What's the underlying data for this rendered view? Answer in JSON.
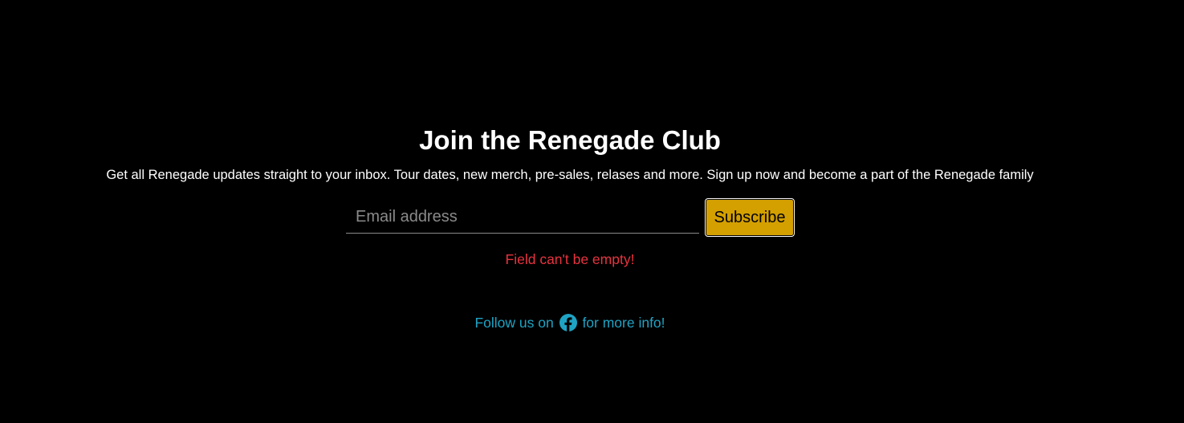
{
  "newsletter": {
    "title": "Join the Renegade Club",
    "subtitle": "Get all Renegade updates straight to your inbox. Tour dates, new merch, pre-sales, relases and more. Sign up now and become a part of the Renegade family",
    "email_placeholder": "Email address",
    "email_value": "",
    "subscribe_label": "Subscribe",
    "error_message": "Field can't be empty!"
  },
  "follow": {
    "prefix": "Follow us on",
    "icon": "facebook-icon",
    "suffix": "for more info!"
  },
  "colors": {
    "background": "#000000",
    "text": "#ffffff",
    "accent_button": "#d4a000",
    "error": "#e8333f",
    "link": "#1fa3c4"
  }
}
